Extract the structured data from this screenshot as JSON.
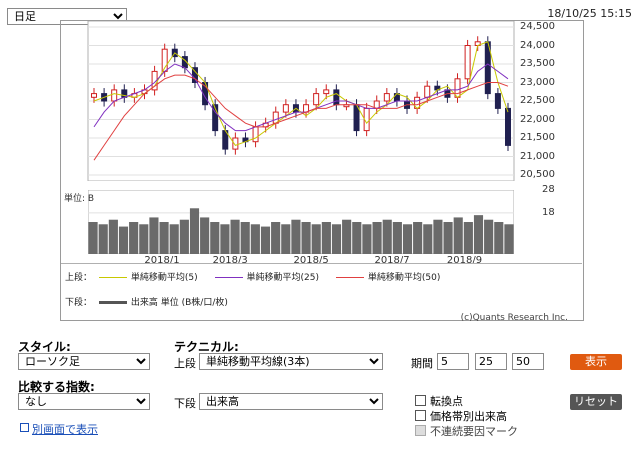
{
  "period_select": {
    "value": "日足"
  },
  "timestamp": "18/10/25 15:15",
  "chart_data": {
    "type": "candlestick",
    "price_panel": {
      "ylim": [
        20500,
        24500
      ],
      "yticks": [
        "24,500",
        "24,000",
        "23,500",
        "23,000",
        "22,500",
        "22,000",
        "21,500",
        "21,000",
        "20,500"
      ],
      "series": [
        {
          "name": "単純移動平均(5)",
          "color": "#c8c800",
          "values": [
            22500,
            22600,
            22700,
            22650,
            22600,
            22700,
            22900,
            23400,
            23800,
            23600,
            23300,
            23000,
            22300,
            21700,
            21300,
            21400,
            21500,
            21700,
            21900,
            22100,
            22300,
            22100,
            22300,
            22600,
            22700,
            22500,
            22400,
            21900,
            22200,
            22400,
            22700,
            22600,
            22300,
            22500,
            22800,
            22900,
            22600,
            22800,
            24000,
            24100,
            23000,
            22200
          ]
        },
        {
          "name": "単純移動平均(25)",
          "color": "#8030c0",
          "values": [
            21800,
            22200,
            22500,
            22600,
            22700,
            22800,
            23000,
            23300,
            23500,
            23400,
            23100,
            22600,
            22200,
            21900,
            21700,
            21700,
            21800,
            21900,
            22000,
            22100,
            22200,
            22200,
            22300,
            22400,
            22500,
            22500,
            22400,
            22300,
            22300,
            22400,
            22500,
            22500,
            22500,
            22600,
            22700,
            22800,
            22800,
            22900,
            23300,
            23500,
            23300,
            23100
          ]
        },
        {
          "name": "単純移動平均(50)",
          "color": "#e04040",
          "values": [
            20900,
            21300,
            21700,
            22100,
            22400,
            22700,
            22900,
            23100,
            23200,
            23200,
            23100,
            22900,
            22600,
            22300,
            22100,
            21900,
            21800,
            21800,
            21900,
            22000,
            22100,
            22200,
            22300,
            22300,
            22400,
            22400,
            22400,
            22400,
            22300,
            22300,
            22300,
            22400,
            22400,
            22500,
            22600,
            22700,
            22700,
            22800,
            22900,
            23000,
            23000,
            22900
          ]
        }
      ],
      "candles_close": [
        22700,
        22500,
        22800,
        22600,
        22700,
        22800,
        23300,
        23900,
        23700,
        23400,
        23000,
        22400,
        21700,
        21200,
        21500,
        21400,
        21800,
        21900,
        22200,
        22400,
        22200,
        22400,
        22700,
        22800,
        22400,
        22400,
        21700,
        22300,
        22500,
        22700,
        22500,
        22300,
        22600,
        22900,
        22800,
        22600,
        23100,
        24000,
        24100,
        22700,
        22300,
        21300
      ]
    },
    "volume_panel": {
      "label": "単位: B",
      "ylim": [
        0,
        28
      ],
      "yticks": [
        "28",
        "18"
      ],
      "values": [
        14,
        13,
        15,
        12,
        14,
        13,
        16,
        14,
        13,
        15,
        20,
        16,
        14,
        13,
        15,
        14,
        13,
        12,
        14,
        13,
        15,
        14,
        13,
        14,
        13,
        15,
        14,
        13,
        14,
        15,
        14,
        13,
        14,
        13,
        15,
        14,
        16,
        14,
        17,
        15,
        14,
        13
      ]
    },
    "x_tick_labels": [
      "2018/1",
      "2018/3",
      "2018/5",
      "2018/7",
      "2018/9"
    ],
    "legend": {
      "upper_label": "上段：",
      "upper_items": [
        "単純移動平均(5)",
        "単純移動平均(25)",
        "単純移動平均(50)"
      ],
      "lower_label": "下段：",
      "lower_items": [
        "出来高 単位 (B株/口/枚)"
      ]
    },
    "credit": "(c)Quants Research Inc."
  },
  "controls": {
    "style_label": "スタイル:",
    "style_value": "ローソク足",
    "compare_label": "比較する指数:",
    "compare_value": "なし",
    "open_window_link": "別画面で表示",
    "technical_label": "テクニカル:",
    "upper_label": "上段",
    "upper_value": "単純移動平均線(3本)",
    "lower_label": "下段",
    "lower_value": "出来高",
    "period_label": "期間",
    "period_values": [
      "5",
      "25",
      "50"
    ],
    "show_button": "表示",
    "reset_button": "リセット",
    "checkboxes": [
      "転換点",
      "価格帯別出来高",
      "不連続要因マーク"
    ],
    "show_button_color": "#e05a10",
    "reset_button_color": "#555555"
  }
}
